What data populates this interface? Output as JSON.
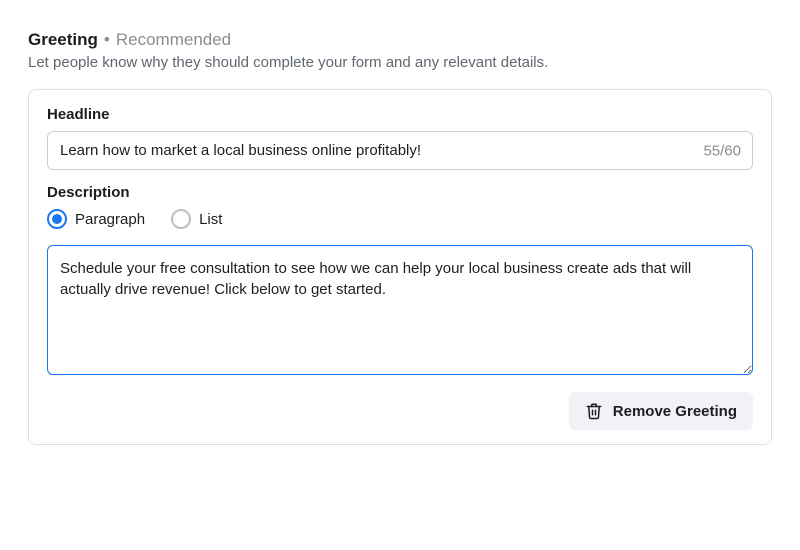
{
  "header": {
    "title": "Greeting",
    "separator": "•",
    "badge": "Recommended",
    "subtitle": "Let people know why they should complete your form and any relevant details."
  },
  "headline": {
    "label": "Headline",
    "value": "Learn how to market a local business online profitably!",
    "counter": "55/60"
  },
  "description": {
    "label": "Description",
    "options": {
      "paragraph": "Paragraph",
      "list": "List"
    },
    "selected": "paragraph",
    "value": "Schedule your free consultation to see how we can help your local business create ads that will actually drive revenue! Click below to get started."
  },
  "actions": {
    "remove": "Remove Greeting"
  }
}
